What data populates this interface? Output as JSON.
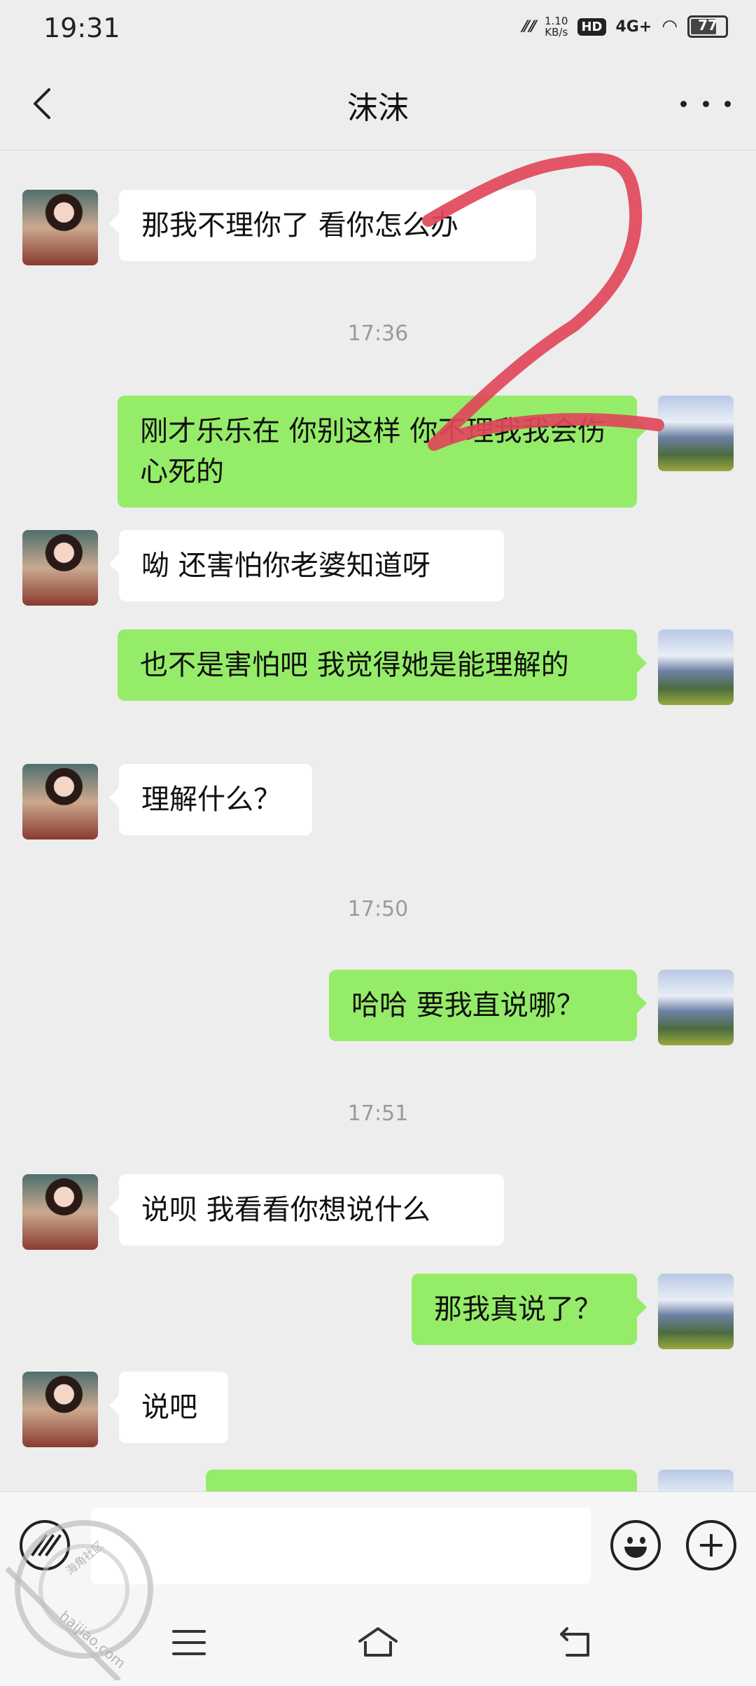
{
  "status": {
    "time": "19:31",
    "speed_value": "1.10",
    "speed_unit": "KB/s",
    "hd": "HD",
    "network": "4G+",
    "battery": "77"
  },
  "header": {
    "title": "沫沫"
  },
  "messages": [
    {
      "type": "in",
      "text": "那我不理你了  看你怎么办"
    },
    {
      "type": "time",
      "text": "17:36"
    },
    {
      "type": "out",
      "text": "刚才乐乐在  你别这样  你不理我我会伤心死的"
    },
    {
      "type": "in",
      "text": "呦  还害怕你老婆知道呀"
    },
    {
      "type": "out",
      "text": "也不是害怕吧  我觉得她是能理解的"
    },
    {
      "type": "in",
      "text": "理解什么？"
    },
    {
      "type": "time",
      "text": "17:50"
    },
    {
      "type": "out",
      "text": "哈哈  要我直说哪？"
    },
    {
      "type": "time",
      "text": "17:51"
    },
    {
      "type": "in",
      "text": "说呗  我看看你想说什么"
    },
    {
      "type": "out",
      "text": "那我真说了？"
    },
    {
      "type": "in",
      "text": "说吧"
    },
    {
      "type": "out",
      "text": ""
    }
  ],
  "watermark": {
    "text": "haijiao.com",
    "cn": "海角社区"
  },
  "colors": {
    "bubble_out": "#95ec69",
    "bubble_in": "#ffffff",
    "background": "#ededed",
    "scribble": "#e0485a"
  }
}
